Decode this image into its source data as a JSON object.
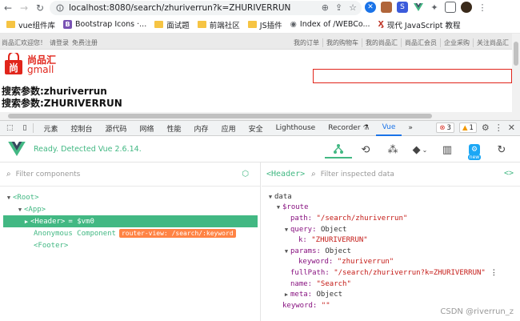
{
  "browser": {
    "url": "localhost:8080/search/zhuriverrun?k=ZHURIVERRUN",
    "bookmarks": [
      {
        "label": "vue组件库",
        "icon": "folder-icon"
      },
      {
        "label": "Bootstrap Icons ·...",
        "icon": "bootstrap-icon"
      },
      {
        "label": "面试题",
        "icon": "folder-icon"
      },
      {
        "label": "前端社区",
        "icon": "folder-icon"
      },
      {
        "label": "JS插件",
        "icon": "folder-icon"
      },
      {
        "label": "Index of /WEBCo...",
        "icon": "globe-icon"
      },
      {
        "label": "现代 JavaScript 教程",
        "icon": "javascript-info-icon"
      }
    ]
  },
  "page": {
    "topbar_left": [
      "尚品汇欢迎您！",
      "请登录",
      "免费注册"
    ],
    "topbar_right": [
      "我的订单",
      "我的购物车",
      "我的尚品汇",
      "尚品汇会员",
      "企业采购",
      "关注尚品汇"
    ],
    "logo_line1": "尚品汇",
    "logo_line2": "gmall",
    "param1": "搜索参数:zhuriverrun",
    "param2": "搜索参数:ZHURIVERRUN"
  },
  "devtools": {
    "tabs": [
      "元素",
      "控制台",
      "源代码",
      "网络",
      "性能",
      "内存",
      "应用",
      "安全",
      "Lighthouse",
      "Recorder",
      "Vue"
    ],
    "active_tab": "Vue",
    "errors": "3",
    "warnings": "1"
  },
  "vue": {
    "status": "Ready. Detected Vue 2.6.14.",
    "new_label": "new",
    "filter_components_placeholder": "Filter components",
    "filter_inspected_placeholder": "Filter inspected data",
    "selected_component": "<Header>",
    "tree": [
      {
        "label": "<Root>",
        "depth": 0,
        "arrow": "▼"
      },
      {
        "label": "<App>",
        "depth": 1,
        "arrow": "▼"
      },
      {
        "label": "<Header>",
        "depth": 2,
        "arrow": "▶",
        "selected": true,
        "vm": "= $vm0"
      },
      {
        "label": "Anonymous Component",
        "depth": 3,
        "badge": "router-view: /search/:keyword"
      },
      {
        "label": "<Footer>",
        "depth": 3
      }
    ],
    "state": {
      "data": "data",
      "route": "$route",
      "path_key": "path:",
      "path_val": "\"/search/zhuriverrun\"",
      "query_key": "query:",
      "query_type": "Object",
      "k_key": "k:",
      "k_val": "\"ZHURIVERRUN\"",
      "params_key": "params:",
      "params_type": "Object",
      "keyword_key": "keyword:",
      "keyword_val": "\"zhuriverrun\"",
      "fullpath_key": "fullPath:",
      "fullpath_val": "\"/search/zhuriverrun?k=ZHURIVERRUN\"",
      "name_key": "name:",
      "name_val": "\"Search\"",
      "meta_key": "meta:",
      "meta_type": "Object",
      "keyword2_key": "keyword:",
      "keyword2_val": "\"\""
    }
  },
  "watermark": "CSDN @riverrun_z",
  "colors": {
    "vue_green": "#42b883",
    "brand_red": "#e1251b",
    "router_badge": "#ff8344"
  }
}
